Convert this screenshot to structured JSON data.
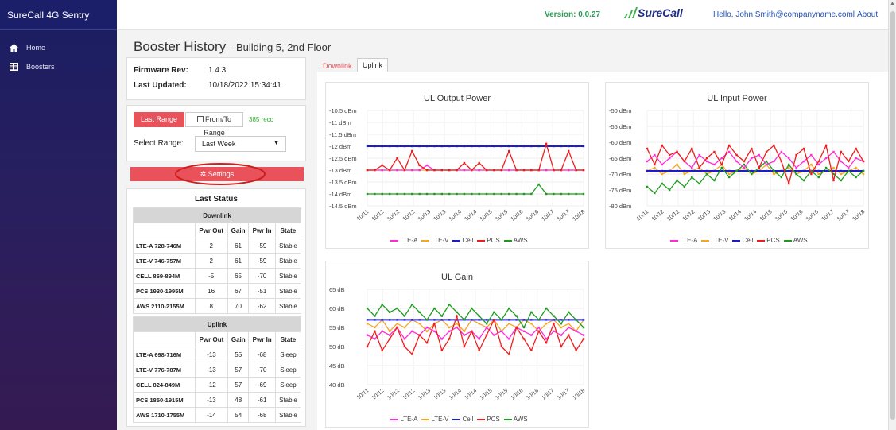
{
  "app": {
    "title": "SureCall 4G Sentry"
  },
  "sidebar": {
    "items": [
      {
        "label": "Home",
        "icon": "home-icon"
      },
      {
        "label": "Boosters",
        "icon": "list-icon"
      }
    ]
  },
  "topbar": {
    "version": "Version: 0.0.27",
    "logo_text": "SureCall",
    "greeting": "Hello, John.Smith@companyname.coml",
    "about": "About"
  },
  "page": {
    "title": "Booster History",
    "subtitle": "- Building 5, 2nd Floor"
  },
  "info": {
    "firmware_label": "Firmware Rev:",
    "firmware_value": "1.4.3",
    "updated_label": "Last Updated:",
    "updated_value": "10/18/2022 15:34:41"
  },
  "range": {
    "last_range_label": "Last Range",
    "from_to_label": "From/To Range",
    "records": "385 reco",
    "select_label": "Select Range:",
    "select_value": "Last Week"
  },
  "settings": {
    "label": "Settings"
  },
  "last_status": {
    "title": "Last Status",
    "columns": [
      "Pwr Out",
      "Gain",
      "Pwr In",
      "State"
    ],
    "downlink": {
      "title": "Downlink",
      "rows": [
        {
          "band": "LTE-A 728-746M",
          "cells": [
            "2",
            "61",
            "-59",
            "Stable"
          ]
        },
        {
          "band": "LTE-V 746-757M",
          "cells": [
            "2",
            "61",
            "-59",
            "Stable"
          ]
        },
        {
          "band": "CELL 869-894M",
          "cells": [
            "-5",
            "65",
            "-70",
            "Stable"
          ]
        },
        {
          "band": "PCS 1930-1995M",
          "cells": [
            "16",
            "67",
            "-51",
            "Stable"
          ]
        },
        {
          "band": "AWS 2110-2155M",
          "cells": [
            "8",
            "70",
            "-62",
            "Stable"
          ]
        }
      ]
    },
    "uplink": {
      "title": "Uplink",
      "rows": [
        {
          "band": "LTE-A 698-716M",
          "cells": [
            "-13",
            "55",
            "-68",
            "Sleep"
          ]
        },
        {
          "band": "LTE-V 776-787M",
          "cells": [
            "-13",
            "57",
            "-70",
            "Sleep"
          ]
        },
        {
          "band": "CELL 824-849M",
          "cells": [
            "-12",
            "57",
            "-69",
            "Sleep"
          ]
        },
        {
          "band": "PCS 1850-1915M",
          "cells": [
            "-13",
            "48",
            "-61",
            "Stable"
          ]
        },
        {
          "band": "AWS 1710-1755M",
          "cells": [
            "-14",
            "54",
            "-68",
            "Stable"
          ]
        }
      ]
    }
  },
  "tabs": [
    {
      "label": "Downlink",
      "active": false
    },
    {
      "label": "Uplink",
      "active": true
    }
  ],
  "colors": {
    "accent_red": "#e9525a",
    "lte_a": "#ff2bd8",
    "lte_v": "#f5a623",
    "cell": "#1c1ccc",
    "pcs": "#ee1c1c",
    "aws": "#1f9a1f"
  },
  "chart_data": [
    {
      "type": "line",
      "title": "UL Output Power",
      "yticks": [
        "-10.5 dBm",
        "-11 dBm",
        "-11.5 dBm",
        "-12 dBm",
        "-12.5 dBm",
        "-13 dBm",
        "-13.5 dBm",
        "-14 dBm",
        "-14.5 dBm"
      ],
      "ylim": [
        -14.5,
        -10.5
      ],
      "xticks": [
        "10/11",
        "10/12",
        "10/12",
        "10/12",
        "10/13",
        "10/13",
        "10/14",
        "10/14",
        "10/15",
        "10/15",
        "10/16",
        "10/16",
        "10/17",
        "10/17",
        "10/18"
      ],
      "legend": [
        "LTE-A",
        "LTE-V",
        "Cell",
        "PCS",
        "AWS"
      ],
      "series": [
        {
          "name": "LTE-A",
          "values": [
            -13,
            -13,
            -13,
            -13,
            -13,
            -13,
            -13,
            -13,
            -12.8,
            -13,
            -13,
            -13,
            -13,
            -13,
            -13,
            -13,
            -13,
            -13,
            -13,
            -13,
            -13,
            -13,
            -13,
            -13,
            -13,
            -13,
            -13,
            -13,
            -13,
            -13
          ]
        },
        {
          "name": "LTE-V",
          "values": [
            -13,
            -13,
            -13,
            -13,
            -13,
            -13,
            -13,
            -13,
            -13,
            -13,
            -13,
            -13,
            -13,
            -13,
            -13,
            -13,
            -13,
            -13,
            -13,
            -13,
            -13,
            -13,
            -13,
            -13,
            -13,
            -13,
            -13,
            -13,
            -13,
            -13
          ]
        },
        {
          "name": "Cell",
          "values": [
            -12,
            -12,
            -12,
            -12,
            -12,
            -12,
            -12,
            -12,
            -12,
            -12,
            -12,
            -12,
            -12,
            -12,
            -12,
            -12,
            -12,
            -12,
            -12,
            -12,
            -12,
            -12,
            -12,
            -12,
            -12,
            -12,
            -12,
            -12,
            -12,
            -12
          ]
        },
        {
          "name": "PCS",
          "values": [
            -13,
            -13,
            -12.8,
            -13,
            -12.5,
            -13,
            -12.2,
            -12.8,
            -13,
            -13,
            -13,
            -13,
            -13,
            -12.7,
            -13,
            -12.7,
            -13,
            -13,
            -13,
            -12.2,
            -13,
            -13,
            -13,
            -13,
            -11.9,
            -13,
            -13,
            -12.2,
            -13,
            -13
          ]
        },
        {
          "name": "AWS",
          "values": [
            -14,
            -14,
            -14,
            -14,
            -14,
            -14,
            -14,
            -14,
            -14,
            -14,
            -14,
            -14,
            -14,
            -14,
            -14,
            -14,
            -14,
            -14,
            -14,
            -14,
            -14,
            -14,
            -14,
            -13.6,
            -14,
            -14,
            -14,
            -14,
            -14,
            -14
          ]
        }
      ]
    },
    {
      "type": "line",
      "title": "UL Input Power",
      "yticks": [
        "-50 dBm",
        "-55 dBm",
        "-60 dBm",
        "-65 dBm",
        "-70 dBm",
        "-75 dBm",
        "-80 dBm"
      ],
      "ylim": [
        -80,
        -50
      ],
      "xticks": [
        "10/11",
        "10/12",
        "10/12",
        "10/12",
        "10/13",
        "10/13",
        "10/14",
        "10/14",
        "10/15",
        "10/15",
        "10/16",
        "10/16",
        "10/17",
        "10/17",
        "10/18"
      ],
      "legend": [
        "LTE-A",
        "LTE-V",
        "Cell",
        "PCS",
        "AWS"
      ],
      "series": [
        {
          "name": "LTE-A",
          "values": [
            -66,
            -64,
            -67,
            -65,
            -63,
            -66,
            -68,
            -64,
            -66,
            -67,
            -65,
            -63,
            -66,
            -68,
            -65,
            -64,
            -67,
            -66,
            -63,
            -65,
            -68,
            -66,
            -64,
            -67,
            -65,
            -63,
            -66,
            -68,
            -65,
            -66
          ]
        },
        {
          "name": "LTE-V",
          "values": [
            -69,
            -68,
            -70,
            -69,
            -67,
            -70,
            -69,
            -68,
            -70,
            -69,
            -67,
            -70,
            -69,
            -68,
            -70,
            -69,
            -67,
            -70,
            -69,
            -68,
            -70,
            -69,
            -67,
            -70,
            -69,
            -68,
            -70,
            -69,
            -68,
            -70
          ]
        },
        {
          "name": "Cell",
          "values": [
            -69,
            -69,
            -69,
            -69,
            -69,
            -69,
            -69,
            -69,
            -69,
            -69,
            -69,
            -69,
            -69,
            -69,
            -69,
            -69,
            -69,
            -69,
            -69,
            -69,
            -69,
            -69,
            -69,
            -69,
            -69,
            -69,
            -69,
            -69,
            -69,
            -69
          ]
        },
        {
          "name": "PCS",
          "values": [
            -62,
            -67,
            -61,
            -64,
            -63,
            -66,
            -62,
            -68,
            -65,
            -63,
            -67,
            -61,
            -64,
            -66,
            -62,
            -68,
            -63,
            -61,
            -66,
            -73,
            -64,
            -62,
            -70,
            -66,
            -61,
            -72,
            -63,
            -66,
            -62,
            -66
          ]
        },
        {
          "name": "AWS",
          "values": [
            -74,
            -76,
            -73,
            -75,
            -72,
            -74,
            -71,
            -73,
            -70,
            -72,
            -68,
            -71,
            -69,
            -67,
            -70,
            -68,
            -66,
            -69,
            -71,
            -67,
            -70,
            -72,
            -69,
            -71,
            -68,
            -70,
            -72,
            -69,
            -71,
            -69
          ]
        }
      ]
    },
    {
      "type": "line",
      "title": "UL Gain",
      "yticks": [
        "65 dB",
        "60 dB",
        "55 dB",
        "50 dB",
        "45 dB",
        "40 dB"
      ],
      "ylim": [
        40,
        65
      ],
      "xticks": [
        "10/11",
        "10/12",
        "10/12",
        "10/12",
        "10/13",
        "10/13",
        "10/14",
        "10/14",
        "10/15",
        "10/15",
        "10/16",
        "10/16",
        "10/17",
        "10/17",
        "10/18"
      ],
      "legend": [
        "LTE-A",
        "LTE-V",
        "Cell",
        "PCS",
        "AWS"
      ],
      "series": [
        {
          "name": "LTE-A",
          "values": [
            53,
            52,
            54,
            53,
            55,
            52,
            54,
            53,
            55,
            54,
            52,
            54,
            55,
            53,
            54,
            52,
            55,
            53,
            54,
            52,
            55,
            54,
            53,
            55,
            52,
            54,
            53,
            55,
            54,
            53
          ]
        },
        {
          "name": "LTE-V",
          "values": [
            56,
            55,
            57,
            54,
            56,
            55,
            57,
            56,
            54,
            56,
            57,
            55,
            56,
            54,
            57,
            56,
            55,
            57,
            54,
            56,
            55,
            57,
            56,
            54,
            56,
            57,
            55,
            56,
            54,
            57
          ]
        },
        {
          "name": "Cell",
          "values": [
            57,
            57,
            57,
            57,
            57,
            57,
            57,
            57,
            57,
            57,
            57,
            57,
            57,
            57,
            57,
            57,
            57,
            57,
            57,
            57,
            57,
            57,
            57,
            57,
            57,
            57,
            57,
            57,
            57,
            57
          ]
        },
        {
          "name": "PCS",
          "values": [
            50,
            54,
            49,
            52,
            55,
            50,
            48,
            53,
            51,
            56,
            49,
            52,
            58,
            50,
            54,
            49,
            53,
            57,
            50,
            48,
            55,
            52,
            49,
            54,
            51,
            56,
            50,
            53,
            49,
            52
          ]
        },
        {
          "name": "AWS",
          "values": [
            60,
            58,
            61,
            59,
            60,
            58,
            61,
            59,
            57,
            60,
            58,
            61,
            59,
            57,
            60,
            58,
            56,
            59,
            57,
            60,
            58,
            55,
            59,
            57,
            60,
            58,
            56,
            59,
            57,
            55
          ]
        }
      ]
    }
  ]
}
